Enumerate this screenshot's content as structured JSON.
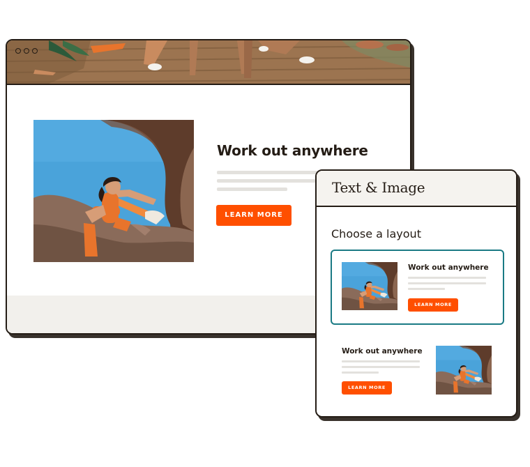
{
  "main_page": {
    "headline": "Work out anywhere",
    "cta_label": "LEARN MORE"
  },
  "panel": {
    "title": "Text & Image",
    "subtitle": "Choose a layout",
    "layouts": [
      {
        "layout": "image-left",
        "headline": "Work out anywhere",
        "cta_label": "LEARN MORE",
        "selected": true
      },
      {
        "layout": "image-right",
        "headline": "Work out anywhere",
        "cta_label": "LEARN MORE",
        "selected": false
      }
    ]
  },
  "icons": {
    "window_controls": "three-dots-icon"
  },
  "colors": {
    "accent": "#ff4f00",
    "selected_border": "#1a7a84",
    "ink": "#241c15",
    "placeholder_line": "#e3e1dd",
    "footer_band": "#f2f0ec"
  }
}
